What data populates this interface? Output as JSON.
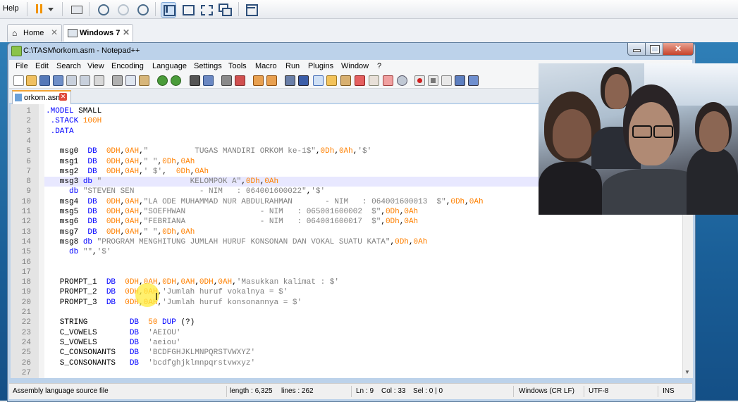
{
  "host": {
    "help_label": "Help",
    "tabs": [
      {
        "label": "Home",
        "icon": "home-icon"
      },
      {
        "label": "Windows 7",
        "icon": "vm-icon"
      }
    ]
  },
  "window": {
    "title": "C:\\TASM\\orkom.asm - Notepad++"
  },
  "menu": [
    "File",
    "Edit",
    "Search",
    "View",
    "Encoding",
    "Language",
    "Settings",
    "Tools",
    "Macro",
    "Run",
    "Plugins",
    "Window",
    "?"
  ],
  "document_tab": {
    "label": "orkom.asm"
  },
  "editor": {
    "lines": [
      {
        "n": "1",
        "text": ".MODEL SMALL"
      },
      {
        "n": "2",
        "text": " .STACK 100H"
      },
      {
        "n": "3",
        "text": " .DATA"
      },
      {
        "n": "4",
        "text": ""
      },
      {
        "n": "5",
        "text": "   msg0  DB  0DH,0AH,\"          TUGAS MANDIRI ORKOM ke-1$\",0Dh,0Ah,'$'"
      },
      {
        "n": "6",
        "text": "   msg1  DB  0DH,0AH,\" \",0Dh,0Ah"
      },
      {
        "n": "7",
        "text": "   msg2  DB  0DH,0AH,' $',  0Dh,0Ah"
      },
      {
        "n": "8",
        "text": "   msg3 db \"                   KELOMPOK A\",0Dh,0Ah"
      },
      {
        "n": "9",
        "text": "     db \"STEVEN SEN              - NIM   : 064001600022\",'$'"
      },
      {
        "n": "10",
        "text": "   msg4  DB  0DH,0AH,\"LA ODE MUHAMMAD NUR ABDULRAHMAN       - NIM   : 064001600013  $\",0Dh,0Ah"
      },
      {
        "n": "11",
        "text": "   msg5  DB  0DH,0AH,\"SOEFHWAN                - NIM   : 065001600002  $\",0Dh,0Ah"
      },
      {
        "n": "12",
        "text": "   msg6  DB  0DH,0AH,\"FEBRIANA                - NIM   : 064001600017  $\",0Dh,0Ah"
      },
      {
        "n": "13",
        "text": "   msg7  DB  0DH,0AH,\" \",0Dh,0Ah"
      },
      {
        "n": "14",
        "text": "   msg8 db \"PROGRAM MENGHITUNG JUMLAH HURUF KONSONAN DAN VOKAL SUATU KATA\",0Dh,0Ah"
      },
      {
        "n": "15",
        "text": "     db \"\",'$'"
      },
      {
        "n": "16",
        "text": ""
      },
      {
        "n": "17",
        "text": ""
      },
      {
        "n": "18",
        "text": "   PROMPT_1  DB  0DH,0AH,0DH,0AH,0DH,0AH,'Masukkan kalimat : $'"
      },
      {
        "n": "19",
        "text": "   PROMPT_2  DB  0DH,0AH,'Jumlah huruf vokalnya = $'"
      },
      {
        "n": "20",
        "text": "   PROMPT_3  DB  0DH,0AH,'Jumlah huruf konsonannya = $'"
      },
      {
        "n": "21",
        "text": ""
      },
      {
        "n": "22",
        "text": "   STRING         DB  50 DUP (?)"
      },
      {
        "n": "23",
        "text": "   C_VOWELS       DB  'AEIOU'"
      },
      {
        "n": "24",
        "text": "   S_VOWELS       DB  'aeiou'"
      },
      {
        "n": "25",
        "text": "   C_CONSONANTS   DB  'BCDFGHJKLMNPQRSTVWXYZ'"
      },
      {
        "n": "26",
        "text": "   S_CONSONANTS   DB  'bcdfghjklmnpqrstvwxyz'"
      },
      {
        "n": "27",
        "text": ""
      }
    ]
  },
  "status": {
    "file_type": "Assembly language source file",
    "length": "length : 6,325",
    "lines": "lines : 262",
    "ln": "Ln : 9",
    "col": "Col : 33",
    "sel": "Sel : 0 | 0",
    "eol": "Windows (CR LF)",
    "encoding": "UTF-8",
    "mode": "INS"
  },
  "colors": {
    "keyword": "#0000ff",
    "number": "#ff8000",
    "string": "#808080",
    "current_line": "#e8e8ff"
  }
}
